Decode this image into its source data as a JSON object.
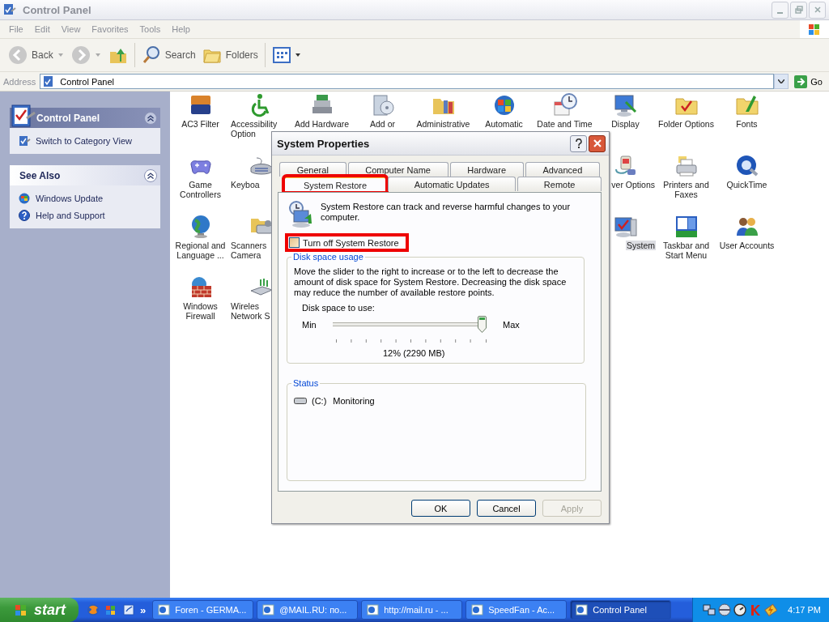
{
  "window": {
    "title": "Control Panel",
    "active": false
  },
  "menu": [
    "File",
    "Edit",
    "View",
    "Favorites",
    "Tools",
    "Help"
  ],
  "toolbar": {
    "back": "Back",
    "search": "Search",
    "folders": "Folders"
  },
  "address": {
    "label": "Address",
    "value": "Control Panel",
    "go": "Go"
  },
  "sidebar": [
    {
      "title": "Control Panel",
      "kind": "primary",
      "links": [
        {
          "label": "Switch to Category View",
          "kind": "category"
        }
      ]
    },
    {
      "title": "See Also",
      "kind": "plain",
      "links": [
        {
          "label": "Windows Update",
          "kind": "update"
        },
        {
          "label": "Help and Support",
          "kind": "help"
        }
      ]
    }
  ],
  "icon_rows": [
    {
      "left": [
        {
          "label": "AC3 Filter",
          "kind": "filter",
          "selected": false
        },
        {
          "label": "Accessibility Option",
          "kind": "wheelchair",
          "selected": false
        },
        {
          "label": "Add Hardware",
          "kind": "hardware",
          "selected": false
        },
        {
          "label": "Add or",
          "kind": "disc",
          "selected": false
        },
        {
          "label": "Administrative",
          "kind": "toolsfolder",
          "selected": false
        },
        {
          "label": "Automatic",
          "kind": "winglobe",
          "selected": false
        },
        {
          "label": "Date and Time",
          "kind": "clock",
          "selected": false
        },
        {
          "label": "Display",
          "kind": "display",
          "selected": false
        },
        {
          "label": "Folder Options",
          "kind": "checkfolder",
          "selected": false
        },
        {
          "label": "Fonts",
          "kind": "fontfolder",
          "selected": false
        }
      ],
      "right": []
    },
    {
      "left": [
        {
          "label": "Game Controllers",
          "kind": "gamepad",
          "selected": false
        },
        {
          "label": "Keyboa",
          "kind": "keyboard",
          "selected": false
        }
      ],
      "right": [
        {
          "label": "ver Options",
          "kind": "power",
          "selected": false
        },
        {
          "label": "Printers and Faxes",
          "kind": "printer",
          "selected": false
        },
        {
          "label": "QuickTime",
          "kind": "qt",
          "selected": false
        }
      ]
    },
    {
      "left": [
        {
          "label": "Regional and Language ...",
          "kind": "globe",
          "selected": false
        },
        {
          "label": "Scanners Camera",
          "kind": "scanner",
          "selected": false
        }
      ],
      "right": [
        {
          "label": "System",
          "kind": "system",
          "selected": true
        },
        {
          "label": "Taskbar and Start Menu",
          "kind": "taskbar",
          "selected": false
        },
        {
          "label": "User Accounts",
          "kind": "users",
          "selected": false
        }
      ]
    },
    {
      "left": [
        {
          "label": "Windows Firewall",
          "kind": "firewall",
          "selected": false
        },
        {
          "label": "Wireles Network S",
          "kind": "wireless",
          "selected": false
        }
      ],
      "right": []
    }
  ],
  "dialog": {
    "title": "System Properties",
    "tab_rows": [
      {
        "tabs": [
          {
            "label": "General",
            "selected": false
          },
          {
            "label": "Computer Name",
            "selected": false
          },
          {
            "label": "Hardware",
            "selected": false
          },
          {
            "label": "Advanced",
            "selected": false
          }
        ]
      },
      {
        "tabs": [
          {
            "label": "System Restore",
            "selected": true,
            "highlighted": true
          },
          {
            "label": "Automatic Updates",
            "selected": false,
            "highlighted": false
          },
          {
            "label": "Remote",
            "selected": false,
            "highlighted": false
          }
        ]
      }
    ],
    "intro": "System Restore can track and reverse harmful changes to your computer.",
    "checkbox": {
      "label": "Turn off System Restore",
      "checked": false,
      "highlighted": true
    },
    "disk": {
      "legend": "Disk space usage",
      "text": "Move the slider to the right to increase or to the left to decrease the amount of disk space for System Restore. Decreasing the disk space may reduce the number of available restore points.",
      "slider_label": "Disk space to use:",
      "min": "Min",
      "max": "Max",
      "level": 1,
      "reading": "12% (2290 MB)"
    },
    "status": {
      "legend": "Status",
      "drives": [
        {
          "drive": "(C:)",
          "state": "Monitoring"
        }
      ]
    },
    "buttons": [
      {
        "label": "OK",
        "disabled": false
      },
      {
        "label": "Cancel",
        "disabled": false
      },
      {
        "label": "Apply",
        "disabled": true
      }
    ]
  },
  "taskbar": {
    "start": "start",
    "more": "»",
    "tasks": [
      {
        "label": "Foren - GERMA...",
        "selected": false
      },
      {
        "label": "@MAIL.RU: по...",
        "selected": false
      },
      {
        "label": "http://mail.ru - ...",
        "selected": false
      },
      {
        "label": "SpeedFan - Ac...",
        "selected": false
      },
      {
        "label": "Control Panel",
        "selected": true
      }
    ],
    "clock": "4:17 PM"
  }
}
